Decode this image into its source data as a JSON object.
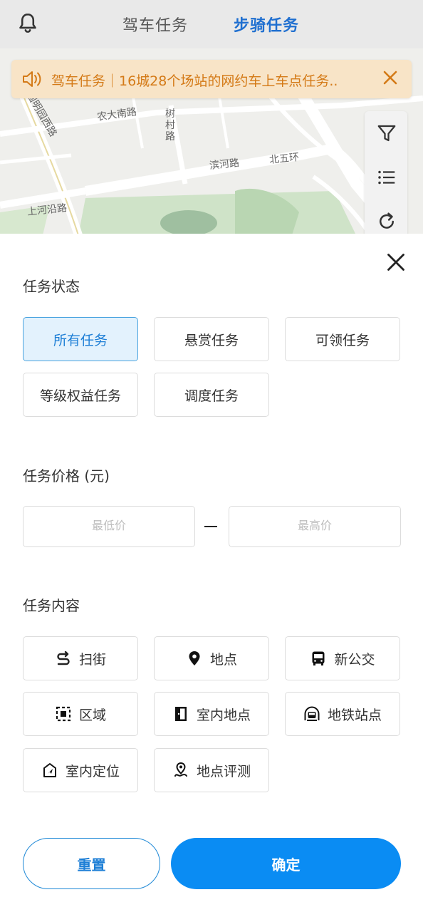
{
  "header": {
    "tabs": [
      "驾车任务",
      "步骑任务"
    ],
    "active_tab": "步骑任务"
  },
  "notice": {
    "text": "驾车任务｜16城28个场站的网约车上车点任务.."
  },
  "map": {
    "labels": [
      "圆明园西路",
      "农大南路",
      "树村路",
      "滨河路",
      "北五环",
      "上河沿路"
    ]
  },
  "filter": {
    "status": {
      "title": "任务状态",
      "options": [
        "所有任务",
        "悬赏任务",
        "可领任务",
        "等级权益任务",
        "调度任务"
      ],
      "selected": "所有任务"
    },
    "price": {
      "title": "任务价格 (元)",
      "min_placeholder": "最低价",
      "max_placeholder": "最高价"
    },
    "content": {
      "title": "任务内容",
      "options": [
        {
          "label": "扫街",
          "icon": "route-icon"
        },
        {
          "label": "地点",
          "icon": "location-pin-icon"
        },
        {
          "label": "新公交",
          "icon": "bus-icon"
        },
        {
          "label": "区域",
          "icon": "area-select-icon"
        },
        {
          "label": "室内地点",
          "icon": "door-icon"
        },
        {
          "label": "地铁站点",
          "icon": "subway-icon"
        },
        {
          "label": "室内定位",
          "icon": "indoor-nav-icon"
        },
        {
          "label": "地点评测",
          "icon": "place-review-icon"
        }
      ]
    }
  },
  "actions": {
    "reset_label": "重置",
    "confirm_label": "确定"
  },
  "colors": {
    "accent": "#0a8cf3",
    "active_bg": "#e3f2fd",
    "notice_text": "#d47a17",
    "notice_bg": "#f8e4c7"
  }
}
